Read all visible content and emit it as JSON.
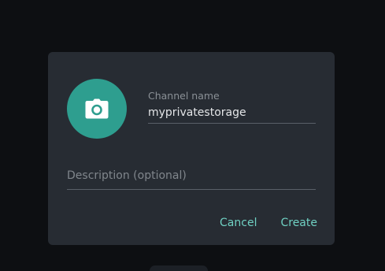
{
  "dialog": {
    "avatar_icon": "camera-icon",
    "channel_name_label": "Channel name",
    "channel_name_value": "myprivatestorage",
    "description_placeholder": "Description (optional)",
    "description_value": "",
    "cancel_label": "Cancel",
    "create_label": "Create"
  },
  "colors": {
    "accent": "#6fd0c2",
    "avatar_background": "#2e9e8f",
    "dialog_background": "#272c33",
    "backdrop": "#0d0f12"
  }
}
